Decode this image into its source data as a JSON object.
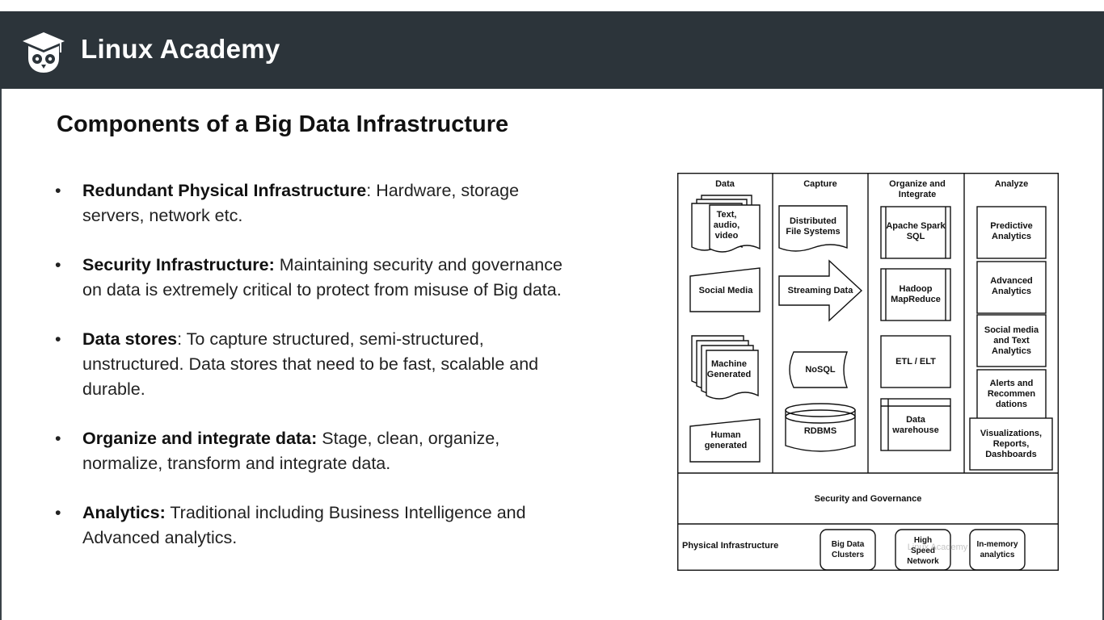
{
  "header": {
    "brand": "Linux Academy",
    "logo_icon": "owl-graduation-cap-icon",
    "background_color": "#2c343a"
  },
  "slide": {
    "title": "Components of a Big Data Infrastructure",
    "bullets": [
      {
        "label": "Redundant Physical Infrastructure",
        "text": ": Hardware, storage servers, network etc."
      },
      {
        "label": "Security Infrastructure:",
        "text": " Maintaining security and governance on data is extremely critical to protect from misuse of Big data."
      },
      {
        "label": "Data stores",
        "text": ": To capture structured, semi-structured, unstructured. Data stores that need to be fast, scalable and durable."
      },
      {
        "label": "Organize and integrate data:",
        "text": " Stage, clean, organize, normalize, transform and integrate data."
      },
      {
        "label": "Analytics:",
        "text": " Traditional including Business Intelligence and Advanced analytics."
      }
    ]
  },
  "diagram": {
    "columns": {
      "data": "Data",
      "capture": "Capture",
      "organize": "Organize and Integrate",
      "analyze": "Analyze"
    },
    "data_items": {
      "text_audio_video": "Text, audio, video",
      "social_media": "Social Media",
      "machine_generated": "Machine Generated",
      "human_generated": "Human generated"
    },
    "capture_items": {
      "dfs": "Distributed File Systems",
      "streaming": "Streaming Data",
      "nosql": "NoSQL",
      "rdbms": "RDBMS"
    },
    "organize_items": {
      "spark": "Apache Spark SQL",
      "hadoop": "Hadoop MapReduce",
      "etl": "ETL / ELT",
      "warehouse": "Data warehouse"
    },
    "analyze_items": {
      "predictive": "Predictive Analytics",
      "advanced": "Advanced Analytics",
      "social_text": "Social media and Text Analytics",
      "alerts": "Alerts and Recommen dations",
      "visualizations": "Visualizations, Reports, Dashboards"
    },
    "security": "Security and Governance",
    "physical": {
      "label": "Physical Infrastructure",
      "clusters": "Big Data Clusters",
      "network": "High Speed Network",
      "inmemory": "In-memory analytics"
    },
    "watermark": "Linux Academy"
  }
}
